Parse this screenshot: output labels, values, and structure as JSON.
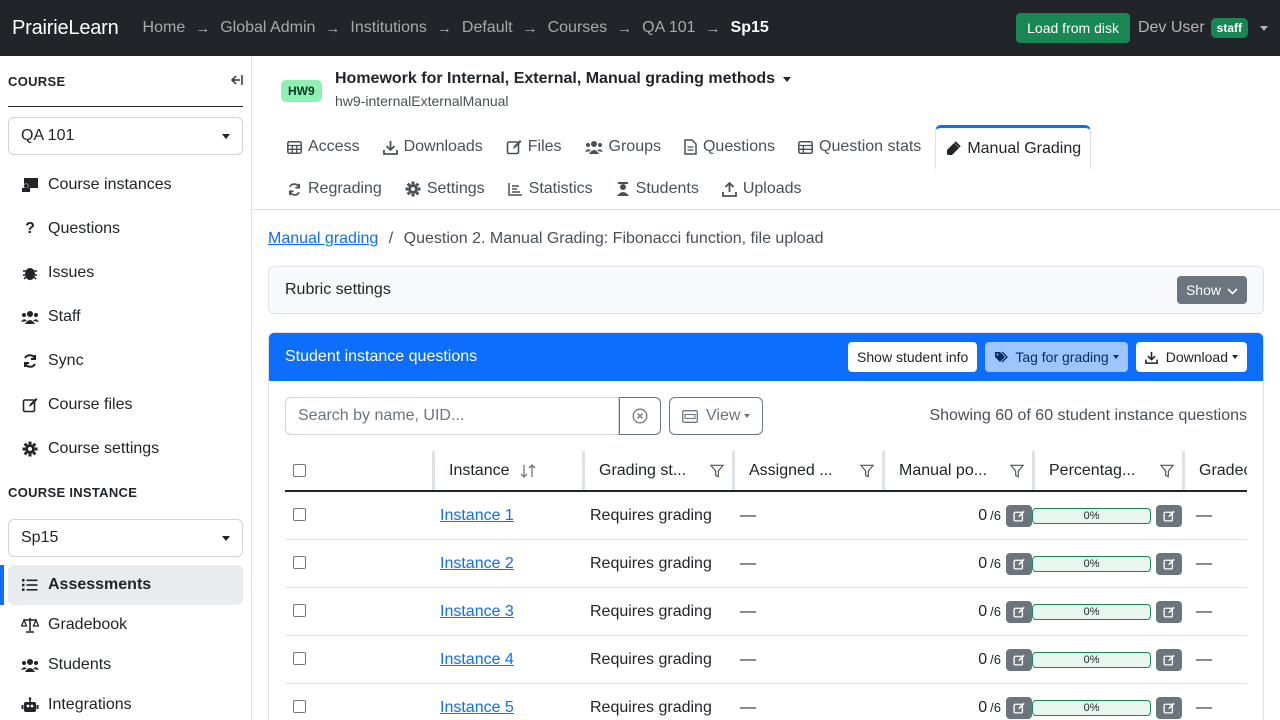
{
  "navbar": {
    "brand": "PrairieLearn",
    "breadcrumbs": [
      "Home",
      "Global Admin",
      "Institutions",
      "Default",
      "Courses",
      "QA 101",
      "Sp15"
    ],
    "load_button": "Load from disk",
    "user_name": "Dev User",
    "user_badge": "staff"
  },
  "sidebar": {
    "course_heading": "COURSE",
    "course_select": "QA 101",
    "course_items": [
      {
        "label": "Course instances",
        "icon": "chalkboard-icon"
      },
      {
        "label": "Questions",
        "icon": "question-icon"
      },
      {
        "label": "Issues",
        "icon": "bug-icon"
      },
      {
        "label": "Staff",
        "icon": "users-icon"
      },
      {
        "label": "Sync",
        "icon": "sync-icon"
      },
      {
        "label": "Course files",
        "icon": "edit-icon"
      },
      {
        "label": "Course settings",
        "icon": "gear-icon"
      }
    ],
    "instance_heading": "COURSE INSTANCE",
    "instance_select": "Sp15",
    "instance_items": [
      {
        "label": "Assessments",
        "icon": "list-icon",
        "active": true
      },
      {
        "label": "Gradebook",
        "icon": "scale-icon"
      },
      {
        "label": "Students",
        "icon": "users-icon"
      },
      {
        "label": "Integrations",
        "icon": "robot-icon"
      }
    ]
  },
  "assessment": {
    "badge": "HW9",
    "title": "Homework for Internal, External, Manual grading methods",
    "subtitle": "hw9-internalExternalManual"
  },
  "tabs": {
    "row1": [
      "Access",
      "Downloads",
      "Files",
      "Groups",
      "Questions",
      "Question stats",
      "Manual Grading"
    ],
    "row2": [
      "Regrading",
      "Settings",
      "Statistics",
      "Students",
      "Uploads"
    ],
    "active": "Manual Grading"
  },
  "breadcrumb": {
    "link": "Manual grading",
    "separator": "/",
    "current": "Question 2. Manual Grading: Fibonacci function, file upload"
  },
  "rubric": {
    "title": "Rubric settings",
    "show_button": "Show"
  },
  "card": {
    "title": "Student instance questions",
    "show_student_info": "Show student info",
    "tag_for_grading": "Tag for grading",
    "download": "Download",
    "search_placeholder": "Search by name, UID...",
    "view_button": "View",
    "showing_text": "Showing 60 of 60 student instance questions"
  },
  "table": {
    "columns": [
      "Instance",
      "Grading st...",
      "Assigned ...",
      "Manual po...",
      "Percentag...",
      "Gradec"
    ],
    "rows": [
      {
        "instance": "Instance 1",
        "status": "Requires grading",
        "assigned": "—",
        "manual": "0",
        "max": "/6",
        "percent": "0%",
        "graded": "—"
      },
      {
        "instance": "Instance 2",
        "status": "Requires grading",
        "assigned": "—",
        "manual": "0",
        "max": "/6",
        "percent": "0%",
        "graded": "—"
      },
      {
        "instance": "Instance 3",
        "status": "Requires grading",
        "assigned": "—",
        "manual": "0",
        "max": "/6",
        "percent": "0%",
        "graded": "—"
      },
      {
        "instance": "Instance 4",
        "status": "Requires grading",
        "assigned": "—",
        "manual": "0",
        "max": "/6",
        "percent": "0%",
        "graded": "—"
      },
      {
        "instance": "Instance 5",
        "status": "Requires grading",
        "assigned": "—",
        "manual": "0",
        "max": "/6",
        "percent": "0%",
        "graded": "—"
      }
    ]
  },
  "colors": {
    "navbar": "#212529",
    "primary": "#0d6efd",
    "success": "#198754",
    "secondary": "#6c757d"
  }
}
